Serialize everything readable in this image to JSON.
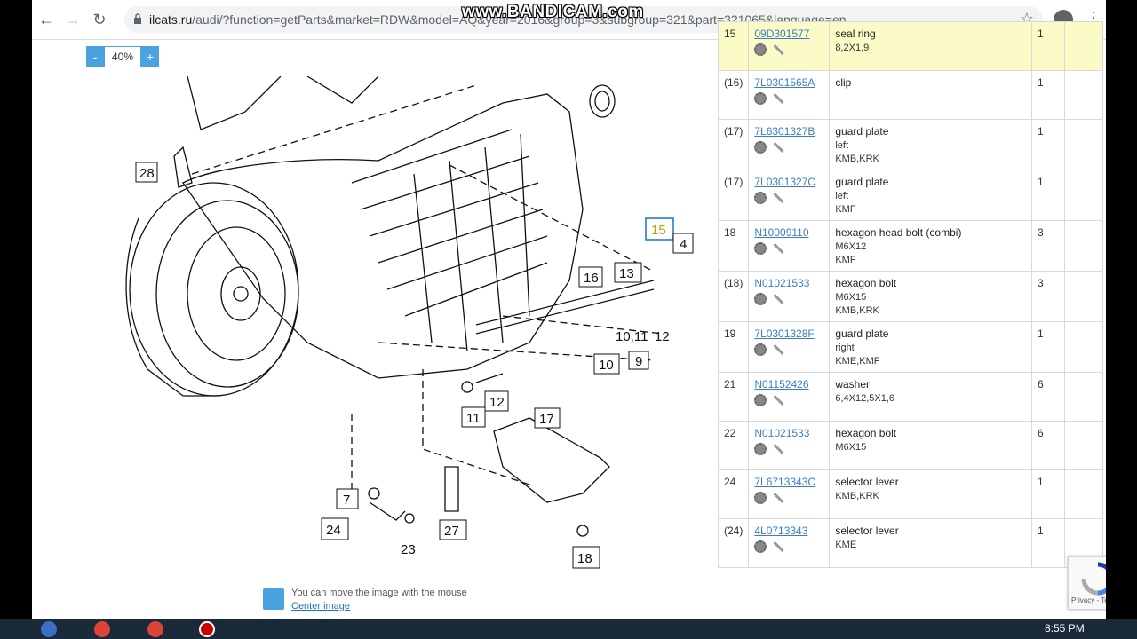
{
  "browser": {
    "url_domain": "ilcats.ru",
    "url_path": "/audi/?function=getParts&market=RDW&model=AQ",
    "url_tail": "&year=2016&group=3&subgroup=321&part=321065&language=en",
    "watermark": "www.BANDICAM.com"
  },
  "zoom": {
    "minus": "-",
    "value": "40%",
    "plus": "+"
  },
  "diagram": {
    "callouts": [
      "28",
      "15",
      "4",
      "13",
      "16",
      "10,11",
      "12",
      "9",
      "10",
      "11",
      "12",
      "17",
      "7",
      "24",
      "23",
      "27",
      "18"
    ]
  },
  "hint": {
    "text": "You can move the image with the mouse",
    "link": "Center image"
  },
  "parts": [
    {
      "pos": "15",
      "number": "09D301577",
      "name": "seal ring",
      "details": [
        "8,2X1,9"
      ],
      "qty": "1",
      "highlight": true
    },
    {
      "pos": "(16)",
      "number": "7L0301565A",
      "name": "clip",
      "details": [],
      "qty": "1"
    },
    {
      "pos": "(17)",
      "number": "7L6301327B",
      "name": "guard plate",
      "details": [
        "left",
        "KMB,KRK"
      ],
      "qty": "1"
    },
    {
      "pos": "(17)",
      "number": "7L0301327C",
      "name": "guard plate",
      "details": [
        "left",
        "KMF"
      ],
      "qty": "1"
    },
    {
      "pos": "18",
      "number": "N10009110",
      "name": "hexagon head bolt (combi)",
      "details": [
        "M6X12",
        "KMF"
      ],
      "qty": "3"
    },
    {
      "pos": "(18)",
      "number": "N01021533",
      "name": "hexagon bolt",
      "details": [
        "M6X15",
        "KMB,KRK"
      ],
      "qty": "3"
    },
    {
      "pos": "19",
      "number": "7L0301328F",
      "name": "guard plate",
      "details": [
        "right",
        "KME,KMF"
      ],
      "qty": "1"
    },
    {
      "pos": "21",
      "number": "N01152426",
      "name": "washer",
      "details": [
        "6,4X12,5X1,6"
      ],
      "qty": "6"
    },
    {
      "pos": "22",
      "number": "N01021533",
      "name": "hexagon bolt",
      "details": [
        "M6X15"
      ],
      "qty": "6"
    },
    {
      "pos": "24",
      "number": "7L6713343C",
      "name": "selector lever",
      "details": [
        "KMB,KRK"
      ],
      "qty": "1"
    },
    {
      "pos": "(24)",
      "number": "4L0713343",
      "name": "selector lever",
      "details": [
        "KME"
      ],
      "qty": "1"
    }
  ],
  "recaptcha": {
    "text": "Privacy - Terms"
  },
  "taskbar": {
    "clock": "8:55 PM"
  }
}
